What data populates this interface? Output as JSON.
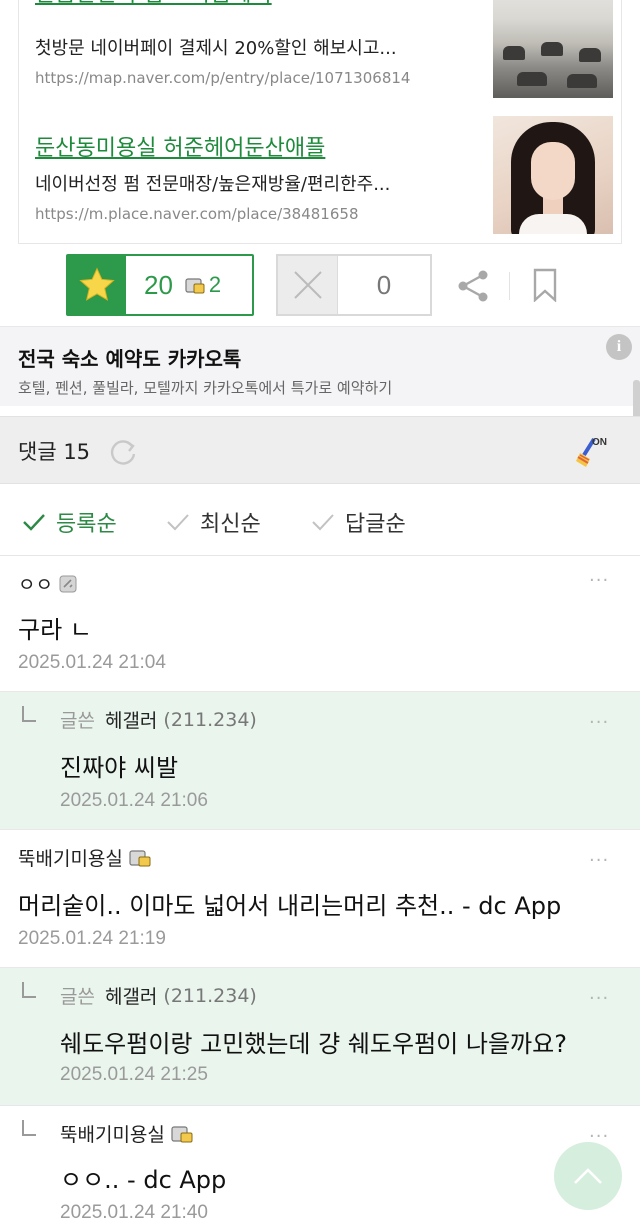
{
  "ads": [
    {
      "title": "깔끔한실력 펌 모나봄헤어",
      "description": "첫방문 네이버페이 결제시 20%할인 해보시고...",
      "url": "https://map.naver.com/p/entry/place/1071306814",
      "thumbnail": "salon-interior-photo"
    },
    {
      "title": "둔산동미용실 허준헤어둔산애플",
      "description": "네이버선정 펌 전문매장/높은재방율/편리한주...",
      "url": "https://m.place.naver.com/place/38481658",
      "thumbnail": "woman-hair-photo"
    }
  ],
  "votes": {
    "recommend_icon": "star-icon",
    "recommend_count": "20",
    "fixed_icon": "fixed-member-icon",
    "fixed_count": "2",
    "nonrecommend_icon": "x-icon",
    "nonrecommend_count": "0",
    "share_icon": "share-icon",
    "bookmark_icon": "bookmark-icon"
  },
  "banner": {
    "title": "전국 숙소 예약도 카카오톡",
    "subtitle": "호텔, 펜션, 풀빌라, 모텔까지 카카오톡에서 특가로 예약하기",
    "info_icon": "i"
  },
  "comments_header": {
    "label": "댓글 15",
    "refresh_icon": "refresh-icon",
    "toggle_icon": "broom-on-icon"
  },
  "sort_options": [
    {
      "label": "등록순",
      "active": true
    },
    {
      "label": "최신순",
      "active": false
    },
    {
      "label": "답글순",
      "active": false
    }
  ],
  "comments": [
    {
      "author": "ㅇㅇ",
      "author_badge": "member-icon",
      "text": "구라 ㄴ",
      "date": "2025.01.24 21:04",
      "reply": false
    },
    {
      "tag": "글쓴",
      "author": "헤갤러",
      "ip": "(211.234)",
      "text": "진짜야 씨발",
      "date": "2025.01.24 21:06",
      "reply": true
    },
    {
      "author": "뚝배기미용실",
      "author_badge": "fixed-member-icon",
      "text": "머리숱이.. 이마도 넓어서 내리는머리 추천.. - dc App",
      "date": "2025.01.24 21:19",
      "reply": false
    },
    {
      "tag": "글쓴",
      "author": "헤갤러",
      "ip": "(211.234)",
      "text": "쉐도우펌이랑 고민했는데 걍 쉐도우펌이 나을까요?",
      "date": "2025.01.24 21:25",
      "reply": true
    },
    {
      "author": "뚝배기미용실",
      "author_badge": "fixed-member-icon",
      "text": "ㅇㅇ.. - dc App",
      "date": "2025.01.24 21:40",
      "reply": true,
      "reply_plain": true
    }
  ],
  "more_label": "···",
  "colors": {
    "accent_green": "#2c9a4a",
    "link_green": "#1e8a3c",
    "reply_bg": "#eaf5ee"
  }
}
